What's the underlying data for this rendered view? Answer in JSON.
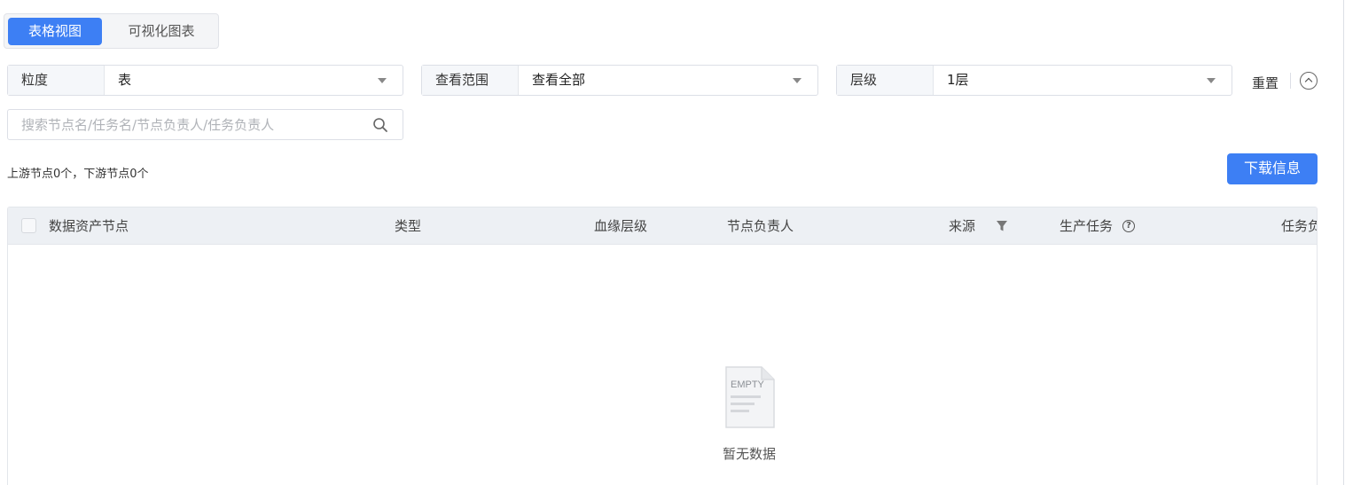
{
  "view_toggle": {
    "table_view": "表格视图",
    "chart_view": "可视化图表"
  },
  "filters": {
    "granularity": {
      "label": "粒度",
      "value": "表"
    },
    "scope": {
      "label": "查看范围",
      "value": "查看全部"
    },
    "level": {
      "label": "层级",
      "value": "1层"
    }
  },
  "actions": {
    "reset_label": "重置",
    "download_label": "下载信息"
  },
  "search": {
    "placeholder": "搜索节点名/任务名/节点负责人/任务负责人",
    "value": ""
  },
  "summary": {
    "text": "上游节点0个，下游节点0个"
  },
  "table": {
    "columns": [
      "数据资产节点",
      "类型",
      "血缘层级",
      "节点负责人",
      "来源",
      "生产任务",
      "任务负"
    ],
    "rows": [],
    "empty_icon_text": "EMPTY",
    "empty_text": "暂无数据"
  },
  "colors": {
    "primary": "#3d7ff4",
    "header_bg": "#edf0f4",
    "border": "#dcdfe6"
  },
  "icons": [
    "caret-down-icon",
    "collapse-up-icon",
    "search-icon",
    "filter-icon",
    "help-icon",
    "empty-file-icon"
  ]
}
